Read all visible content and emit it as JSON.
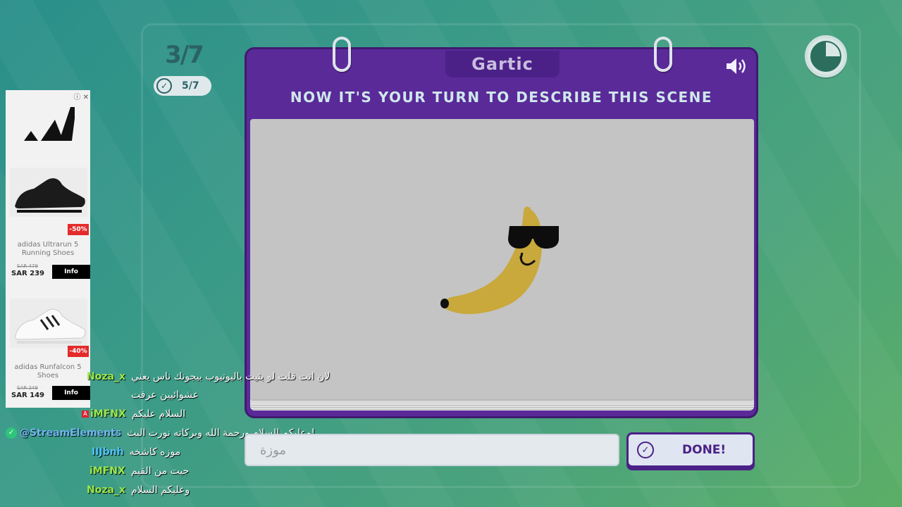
{
  "round": {
    "label": "3/7"
  },
  "progress": {
    "done_count": "5/7",
    "check_icon": "check-circle-icon"
  },
  "timer": {
    "icon": "timer-pie-icon",
    "remaining_fraction": 0.75
  },
  "book": {
    "logo": "Gartic",
    "prompt": "NOW IT'S YOUR TURN TO DESCRIBE THIS SCENE",
    "sound_icon": "speaker-icon"
  },
  "ad": {
    "close_icons": [
      "info-icon",
      "close-icon"
    ],
    "brand_logo": "adidas-logo",
    "products": [
      {
        "discount": "-50%",
        "name": "adidas Ultrarun 5 Running Shoes",
        "old_price": "SAR 479",
        "price": "SAR 239",
        "button": "Info"
      },
      {
        "discount": "-40%",
        "name": "adidas Runfalcon 5 Shoes",
        "old_price": "SAR 249",
        "price": "SAR 149",
        "button": "Info"
      }
    ]
  },
  "chat": [
    {
      "user": "Noza_x",
      "color": "#9be84a",
      "text": "لان انت قلت لو بثيت باليوتيوب بيجونك ناس يعني"
    },
    {
      "user": "",
      "color": "#ffffff",
      "text": "عشوائيين عرفت"
    },
    {
      "user": "iMFNX",
      "color": "#9be84a",
      "text": "السلام عليكم"
    },
    {
      "user": "@StreamElements",
      "color": "#6fb6f0",
      "text": "وعليكم السلام ورحمة الله وبركاته نورت البث!"
    },
    {
      "user": "IIJbnh",
      "color": "#4fc3f7",
      "text": "موزه كاشخه"
    },
    {
      "user": "iMFNX",
      "color": "#9be84a",
      "text": "جيت من القيم"
    },
    {
      "user": "Noza_x",
      "color": "#9be84a",
      "text": "وعليكم السلام"
    }
  ],
  "answer": {
    "value": "موزة"
  },
  "done_button": {
    "label": "DONE!",
    "icon": "check-circle-icon"
  }
}
